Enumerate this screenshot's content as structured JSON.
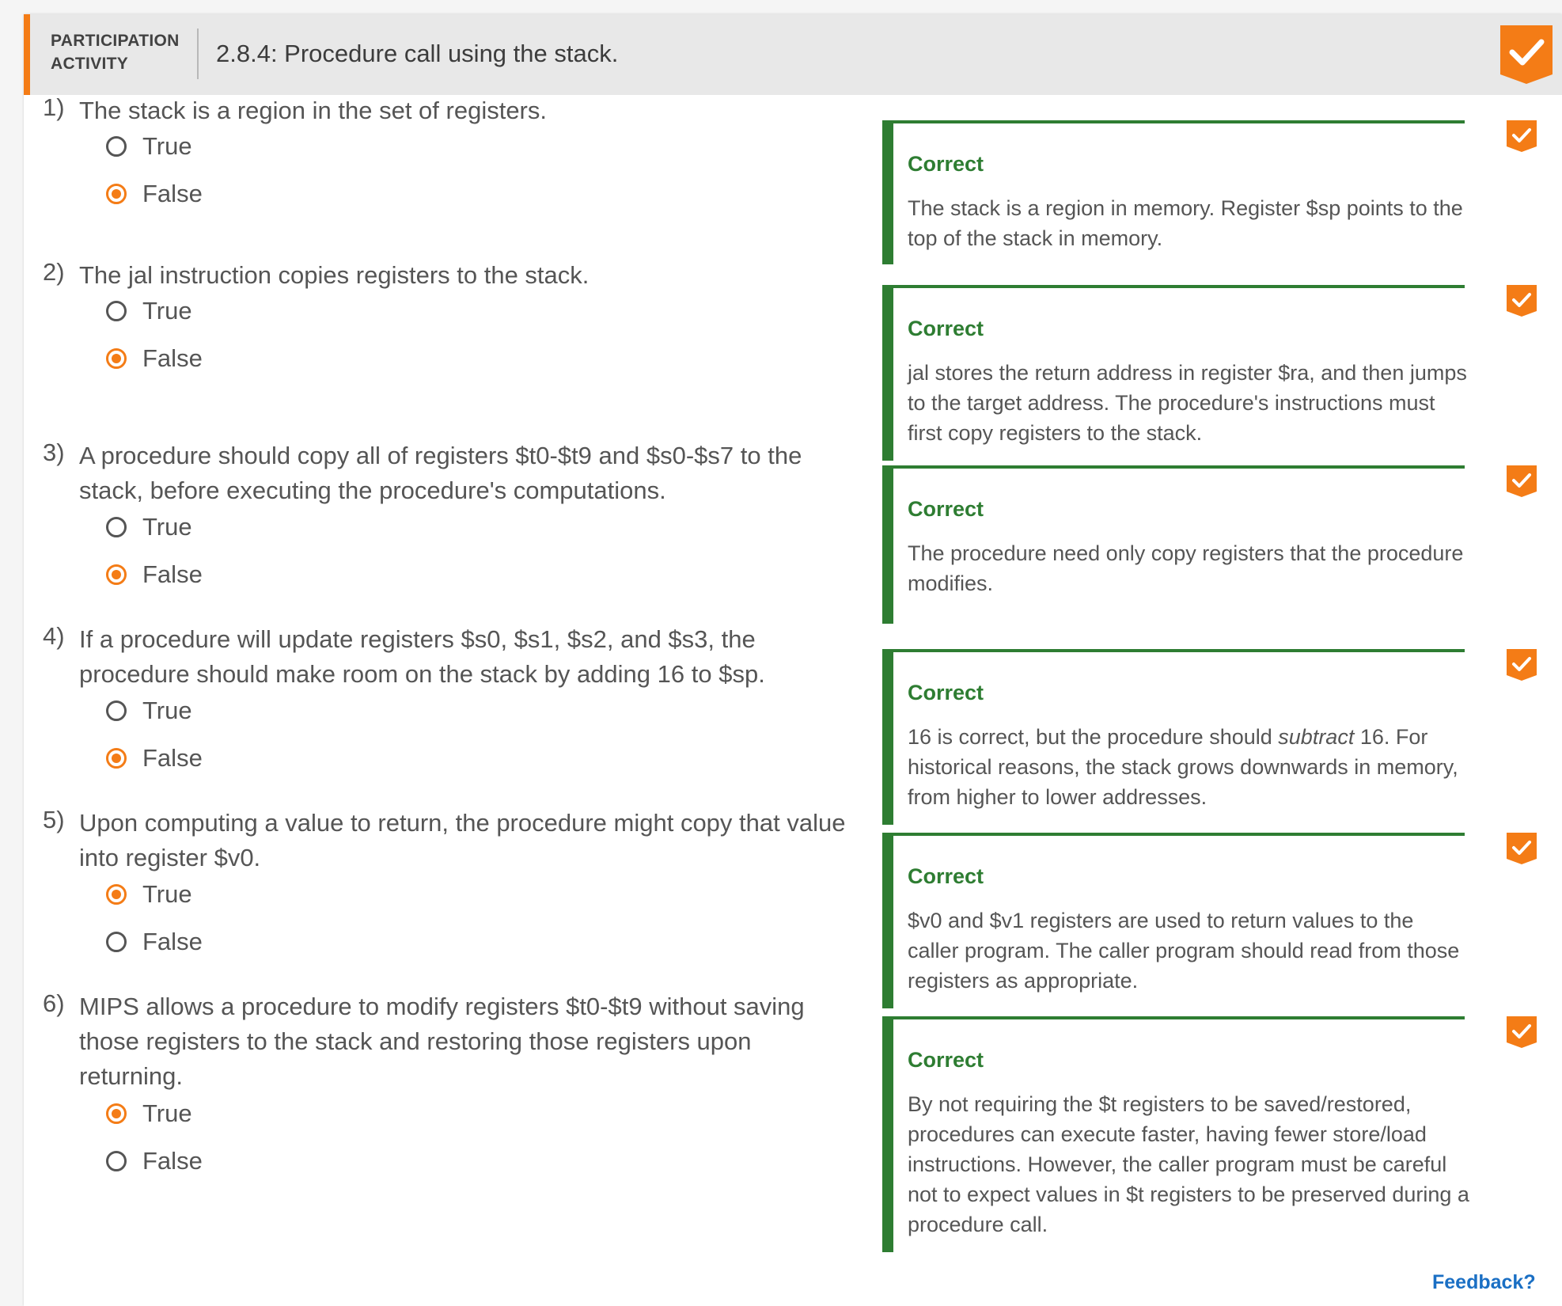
{
  "header": {
    "label_line1": "PARTICIPATION",
    "label_line2": "ACTIVITY",
    "title": "2.8.4: Procedure call using the stack."
  },
  "colors": {
    "accent": "#f47c16",
    "correct": "#2e7d32",
    "link": "#1a6fc4"
  },
  "questions": [
    {
      "num": "1)",
      "text": "The stack is a region in the set of registers.",
      "options": [
        "True",
        "False"
      ],
      "selected": 1,
      "feedback_head": "Correct",
      "feedback": "The stack is a region in memory. Register $sp points to the top of the stack in memory."
    },
    {
      "num": "2)",
      "text": "The jal instruction copies registers to the stack.",
      "options": [
        "True",
        "False"
      ],
      "selected": 1,
      "feedback_head": "Correct",
      "feedback": "jal stores the return address in register $ra, and then jumps to the target address. The procedure's instructions must first copy registers to the stack."
    },
    {
      "num": "3)",
      "text": "A procedure should copy all of registers $t0-$t9 and $s0-$s7 to the stack, before executing the procedure's computations.",
      "options": [
        "True",
        "False"
      ],
      "selected": 1,
      "feedback_head": "Correct",
      "feedback": "The procedure need only copy registers that the procedure modifies."
    },
    {
      "num": "4)",
      "text": "If a procedure will update registers $s0, $s1, $s2, and $s3, the procedure should make room on the stack by adding 16 to $sp.",
      "options": [
        "True",
        "False"
      ],
      "selected": 1,
      "feedback_head": "Correct",
      "feedback_pre": "16 is correct, but the procedure should ",
      "feedback_em": "subtract",
      "feedback_post": " 16. For historical reasons, the stack grows downwards in memory, from higher to lower addresses."
    },
    {
      "num": "5)",
      "text": "Upon computing a value to return, the procedure might copy that value into register $v0.",
      "options": [
        "True",
        "False"
      ],
      "selected": 0,
      "feedback_head": "Correct",
      "feedback": "$v0 and $v1 registers are used to return values to the caller program. The caller program should read from those registers as appropriate."
    },
    {
      "num": "6)",
      "text": "MIPS allows a procedure to modify registers $t0-$t9 without saving those registers to the stack and restoring those registers upon returning.",
      "options": [
        "True",
        "False"
      ],
      "selected": 0,
      "feedback_head": "Correct",
      "feedback": "By not requiring the $t registers to be saved/restored, procedures can execute faster, having fewer store/load instructions. However, the caller program must be careful not to expect values in $t registers to be preserved during a procedure call."
    }
  ],
  "footer": {
    "feedback_link": "Feedback?"
  },
  "icons": {
    "completion": "checkmark-badge-icon",
    "question_done": "checkmark-badge-icon",
    "radio": "radio-button"
  }
}
